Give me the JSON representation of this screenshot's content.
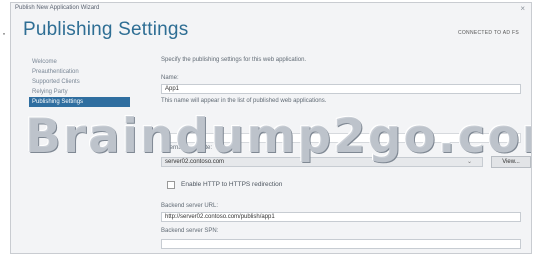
{
  "bullet": "·",
  "window": {
    "title": "Publish New Application Wizard",
    "close_glyph": "×"
  },
  "page": {
    "heading": "Publishing Settings",
    "status": "CONNECTED TO AD FS"
  },
  "sidebar": {
    "items": [
      {
        "label": "Welcome"
      },
      {
        "label": "Preauthentication"
      },
      {
        "label": "Supported Clients"
      },
      {
        "label": "Relying Party"
      },
      {
        "label": "Publishing Settings",
        "active": true
      }
    ]
  },
  "form": {
    "intro": "Specify the publishing settings for this web application.",
    "name_label": "Name:",
    "name_value": "App1",
    "name_hint": "This name will appear in the list of published web applications.",
    "cert_label": "External certificate:",
    "cert_value": "server02.contoso.com",
    "view_label": "View...",
    "redirect_label": "Enable HTTP to HTTPS redirection",
    "backend_url_label": "Backend server URL:",
    "backend_url_value": "http://server02.contoso.com/publish/app1",
    "backend_spn_label": "Backend server SPN:"
  },
  "watermark": "Braindump2go.com",
  "colors": {
    "accent": "#2f6ea0",
    "heading": "#2e6e94"
  }
}
